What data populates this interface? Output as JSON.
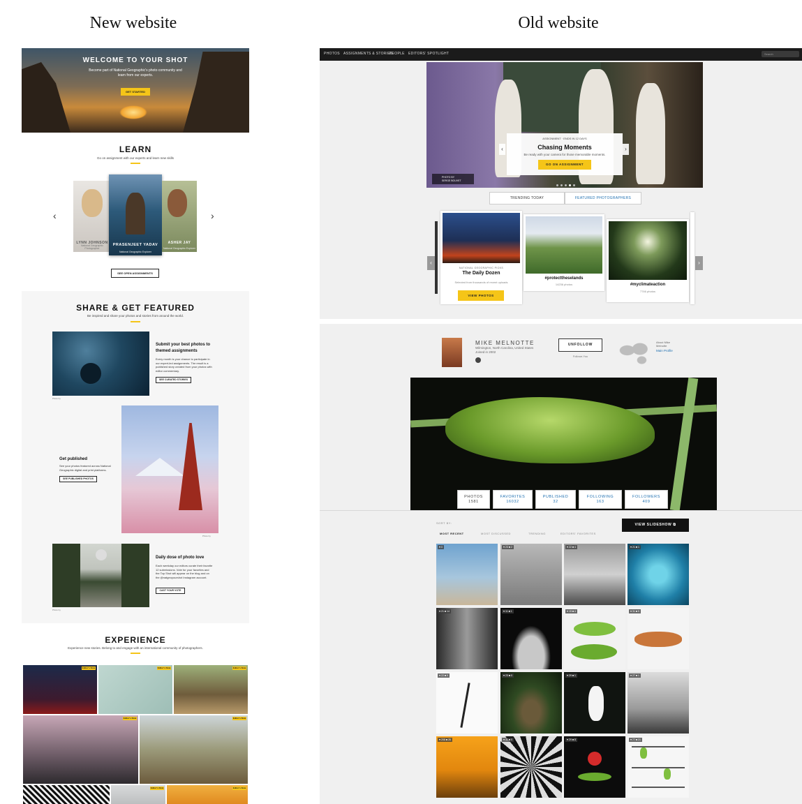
{
  "captions": {
    "new": "New website",
    "old": "Old website"
  },
  "new_site": {
    "hero": {
      "title": "WELCOME TO YOUR SHOT",
      "subtitle": "Become part of National Geographic's photo community and learn from our experts.",
      "cta": "GET STARTED"
    },
    "learn": {
      "title": "LEARN",
      "subtitle": "Go on assignment with our experts and learn new skills",
      "people": [
        {
          "name": "LYNN JOHNSON",
          "role": "National Geographic Photographer"
        },
        {
          "name": "PRASENJEET YADAV",
          "role": "National Geographic Explorer"
        },
        {
          "name": "ASHER JAY",
          "role": "National Geographic Explorer"
        }
      ],
      "button": "SEE OPEN ASSIGNMENTS"
    },
    "share": {
      "title": "SHARE & GET FEATURED",
      "subtitle": "Be inspired and share your photos and stories from around the world.",
      "features": [
        {
          "heading": "Submit your best photos to themed assignments",
          "body": "Every month is your chance to participate in our expert-led assignments. The result is a published story created from your photos with editor commentary.",
          "button": "SEE CURATED STORIES"
        },
        {
          "heading": "Get published",
          "body": "See your photos featured across National Geographic digital and print platforms.",
          "button": "SEE PUBLISHED PHOTOS"
        },
        {
          "heading": "Daily dose of photo love",
          "body": "Each weekday our editors curate their favorite 12 submissions. Vote for your favorites and the Top Shot will appear on the blog and on the @natgeoyourshot Instagram account.",
          "button": "CAST YOUR VOTE"
        }
      ]
    },
    "experience": {
      "title": "EXPERIENCE",
      "subtitle": "Experience new stories. Belong to and engage with an international community of photographers.",
      "badge": "Editor's Note"
    }
  },
  "old_site": {
    "nav": [
      "PHOTOS",
      "ASSIGNMENTS & STORIES",
      "PEOPLE",
      "EDITORS' SPOTLIGHT"
    ],
    "search_placeholder": "Search",
    "promo": {
      "kicker": "ASSIGNMENT · ENDS IN 12 DAYS",
      "title": "Chasing Moments",
      "desc": "Be ready with your camera for those memorable moments.",
      "button": "GO ON ASSIGNMENT"
    },
    "photo_by": {
      "label": "PHOTO BY",
      "name": "SERGE BOUVET"
    },
    "tabs": [
      "TRENDING TODAY",
      "FEATURED PHOTOGRAPHERS"
    ],
    "cards": [
      {
        "kicker": "NATIONAL GEOGRAPHIC PICKS",
        "title": "The Daily Dozen",
        "sub": "Selected from thousands of recent uploads",
        "button": "VIEW PHOTOS"
      },
      {
        "title": "#protecttheselands",
        "sub": "14236 photos"
      },
      {
        "title": "#myclimateaction",
        "sub": "7746 photos"
      }
    ],
    "profile": {
      "name": "MIKE MELNOTTE",
      "location": "Wilmington, North Carolina, United States",
      "joined": "Joined in 2002",
      "unfollow": "UNFOLLOW",
      "follows_you": "Follows You",
      "about": "About Mike Melnotte",
      "main_profile": "Main Profile"
    },
    "stats": [
      {
        "label": "PHOTOS",
        "value": "1581"
      },
      {
        "label": "FAVORITES",
        "value": "16032"
      },
      {
        "label": "PUBLISHED",
        "value": "32"
      },
      {
        "label": "FOLLOWING",
        "value": "163"
      },
      {
        "label": "FOLLOWERS",
        "value": "409"
      }
    ],
    "sort_by": "SORT BY:",
    "sort_options": [
      "MOST RECENT",
      "MOST DISCUSSED",
      "TRENDING",
      "EDITORS' FAVORITES"
    ],
    "slideshow": "VIEW SLIDESHOW",
    "grid_meta": [
      "♥ 0",
      "♥ 23  ■ 2",
      "♥ 22  ■ 4",
      "♥ 21  ■ 1",
      "♥ 21  ■ 14",
      "♥ 11  ■ 1",
      "♥ 15  ■ 4",
      "♥ 31  ■ 5",
      "♥ 22  ■ 0",
      "♥ 23  ■ 0",
      "♥ 29  ■ 1",
      "♥ 27  ■ 1",
      "♥ 208  ■ 28",
      "♥ 31  ■ 0",
      "♥ 29  ■ 8",
      "♥ 77  ■ 21"
    ]
  }
}
